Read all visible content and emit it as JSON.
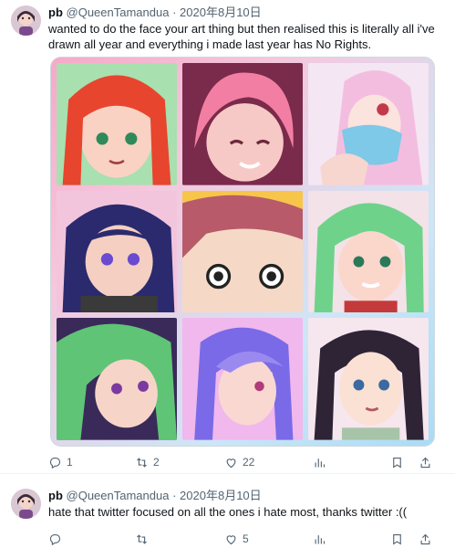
{
  "tweets": [
    {
      "name": "pb",
      "handle": "@QueenTamandua",
      "separator": "·",
      "date": "2020年8月10日",
      "text": "wanted to do the face your art thing but then realised this is literally all i've drawn all year and everything i made last year has No Rights.",
      "replies": "1",
      "retweets": "2",
      "likes": "22"
    },
    {
      "name": "pb",
      "handle": "@QueenTamandua",
      "separator": "·",
      "date": "2020年8月10日",
      "text": "hate that twitter focused on all the ones i hate most, thanks twitter :((",
      "replies": "",
      "retweets": "",
      "likes": "5"
    }
  ],
  "icons": [
    "reply-icon",
    "retweet-icon",
    "like-icon",
    "views-icon",
    "bookmark-icon",
    "share-icon"
  ],
  "colors": {
    "text": "#0f1419",
    "muted": "#536471",
    "border": "#cfd9de"
  }
}
